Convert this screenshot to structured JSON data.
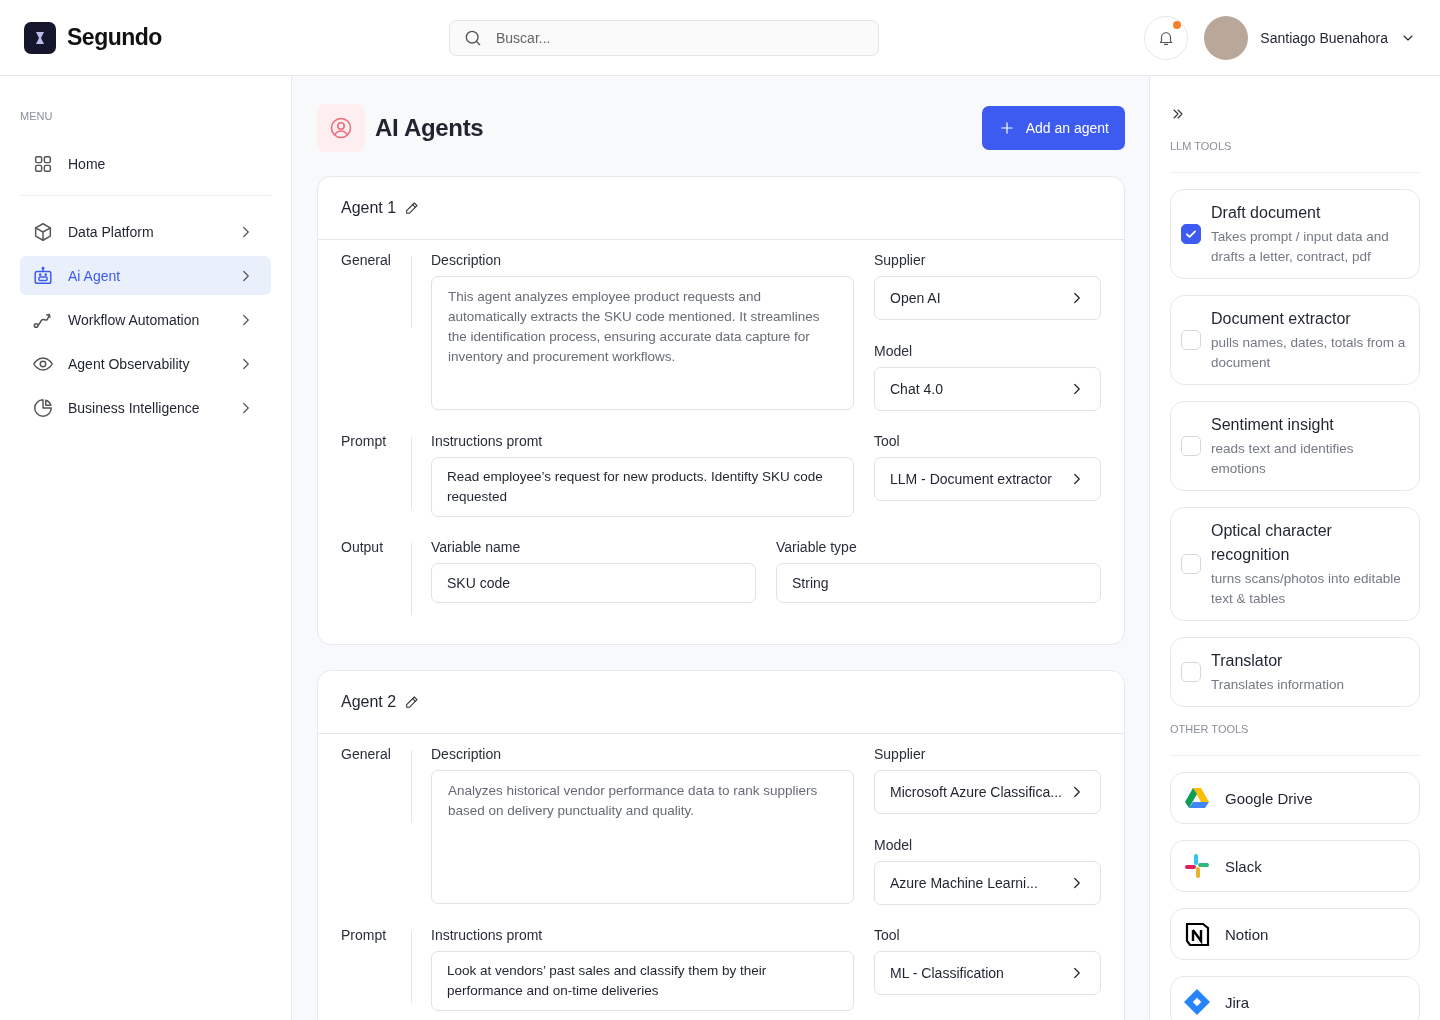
{
  "brand": {
    "name": "Segundo"
  },
  "search": {
    "placeholder": "Buscar..."
  },
  "notifications": {
    "unread": true
  },
  "user": {
    "name": "Santiago Buenahora"
  },
  "sidebar": {
    "heading": "MENU",
    "items": [
      {
        "label": "Home",
        "kind": "grid",
        "selected": false,
        "has_submenu": false
      },
      {
        "label": "Data Platform",
        "kind": "cube",
        "selected": false,
        "has_submenu": true
      },
      {
        "label": "Ai Agent",
        "kind": "robot",
        "selected": true,
        "has_submenu": true
      },
      {
        "label": "Workflow Automation",
        "kind": "workflow",
        "selected": false,
        "has_submenu": true
      },
      {
        "label": "Agent Observability",
        "kind": "eye",
        "selected": false,
        "has_submenu": true
      },
      {
        "label": "Business Intelligence",
        "kind": "pie",
        "selected": false,
        "has_submenu": true
      }
    ]
  },
  "page": {
    "title": "AI Agents",
    "add_button": "Add an agent"
  },
  "agents": [
    {
      "name": "Agent 1",
      "general": {
        "label": "General",
        "description_label": "Description",
        "description": "This agent analyzes employee product requests and automatically extracts the SKU code mentioned. It streamlines the identification process, ensuring accurate data capture for inventory and procurement workflows.",
        "supplier_label": "Supplier",
        "supplier": "Open AI",
        "model_label": "Model",
        "model": "Chat 4.0"
      },
      "prompt": {
        "label": "Prompt",
        "instructions_label": "Instructions promt",
        "instructions": "Read employee’s request for new products. Identifty SKU code requested",
        "tool_label": "Tool",
        "tool": "LLM - Document extractor"
      },
      "output": {
        "label": "Output",
        "variable_name_label": "Variable name",
        "variable_name": "SKU code",
        "variable_type_label": "Variable type",
        "variable_type": "String"
      }
    },
    {
      "name": "Agent 2",
      "general": {
        "label": "General",
        "description_label": "Description",
        "description": "Analyzes historical vendor performance data to rank suppliers based on delivery punctuality and quality.",
        "supplier_label": "Supplier",
        "supplier": "Microsoft Azure Classifica...",
        "model_label": "Model",
        "model": "Azure Machine Learni..."
      },
      "prompt": {
        "label": "Prompt",
        "instructions_label": "Instructions promt",
        "instructions": "Look at vendors’ past sales and classify them by their performance and on-time deliveries",
        "tool_label": "Tool",
        "tool": "ML - Classification"
      }
    }
  ],
  "tools_panel": {
    "llm_heading": "LLM TOOLS",
    "llm_tools": [
      {
        "title": "Draft document",
        "description": "Takes prompt / input data and drafts a letter, contract, pdf",
        "checked": true
      },
      {
        "title": "Document extractor",
        "description": "pulls names, dates, totals from a document",
        "checked": false
      },
      {
        "title": "Sentiment insight",
        "description": "reads text and identifies emotions",
        "checked": false
      },
      {
        "title": "Optical character recognition",
        "description": "turns scans/photos into editable text & tables",
        "checked": false
      },
      {
        "title": "Translator",
        "description": "Translates information",
        "checked": false
      }
    ],
    "other_heading": "OTHER TOOLS",
    "other_tools": [
      {
        "name": "Google Drive",
        "kind": "drive"
      },
      {
        "name": "Slack",
        "kind": "slack"
      },
      {
        "name": "Notion",
        "kind": "notion"
      },
      {
        "name": "Jira",
        "kind": "jira"
      }
    ]
  }
}
